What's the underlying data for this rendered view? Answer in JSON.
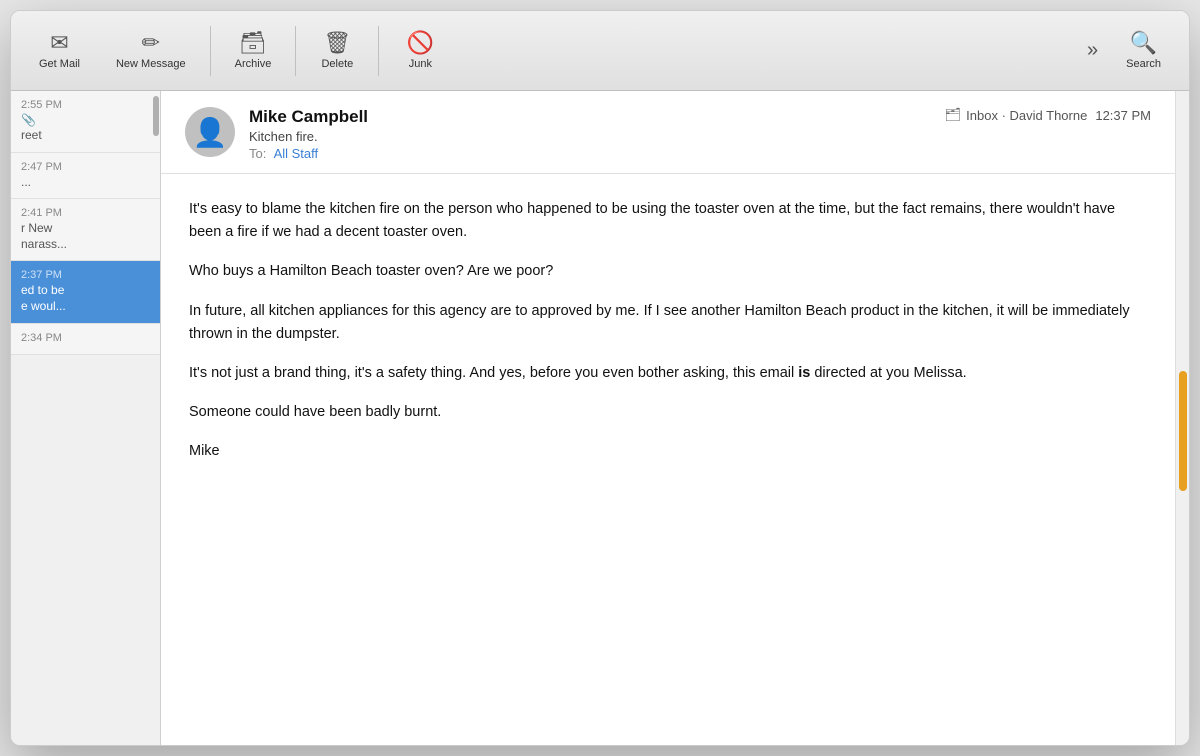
{
  "toolbar": {
    "get_mail_label": "Get Mail",
    "new_message_label": "New Message",
    "archive_label": "Archive",
    "delete_label": "Delete",
    "junk_label": "Junk",
    "search_label": "Search",
    "more_icon": "chevron-right-right-icon"
  },
  "sidebar": {
    "items": [
      {
        "time": "2:55 PM",
        "icon": "📎",
        "text": "reet",
        "selected": false
      },
      {
        "time": "2:47 PM",
        "icon": "",
        "text": "...",
        "selected": false
      },
      {
        "time": "2:41 PM",
        "icon": "",
        "text": "r New\nnarass...",
        "selected": false
      },
      {
        "time": "2:37 PM",
        "icon": "",
        "text": "ed to be\ne woul...",
        "selected": true
      },
      {
        "time": "2:34 PM",
        "icon": "",
        "text": "",
        "selected": false
      }
    ]
  },
  "email": {
    "sender": "Mike Campbell",
    "subject": "Kitchen fire.",
    "to_label": "To:",
    "to_value": "All Staff",
    "inbox_label": "Inbox · David Thorne",
    "time": "12:37 PM",
    "body_paragraphs": [
      "It's easy to blame the kitchen fire on the person who happened to be using the toaster oven at the time, but the fact remains, there wouldn't have been a fire if we had a decent toaster oven.",
      "Who buys a Hamilton Beach toaster oven? Are we poor?",
      "In future, all kitchen appliances for this agency are to approved by me. If I see another Hamilton Beach product in the kitchen, it will be immediately thrown in the dumpster.",
      "It's not just a brand thing, it's a safety thing. And yes, before you even bother asking, this email is directed at you Melissa.",
      "Someone could have been badly burnt.",
      "Mike"
    ],
    "body_bold_word": "is"
  }
}
